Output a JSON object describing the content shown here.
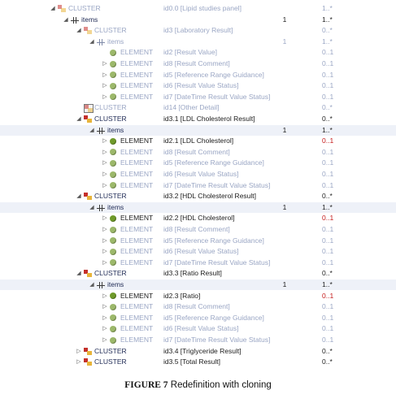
{
  "rows": [
    {
      "depth": 0,
      "expander": "collapse",
      "kind": "cluster",
      "label": "CLUSTER",
      "text": "id0.0 [Lipid studies panel]",
      "occ": "",
      "card": "1..*",
      "dim": true
    },
    {
      "depth": 1,
      "expander": "collapse",
      "kind": "items",
      "label": "items",
      "text": "",
      "occ": "1",
      "card": "1..*",
      "dim": false
    },
    {
      "depth": 2,
      "expander": "collapse",
      "kind": "cluster",
      "label": "CLUSTER",
      "text": "id3 [Laboratory Result]",
      "occ": "",
      "card": "0..*",
      "dim": true
    },
    {
      "depth": 3,
      "expander": "collapse",
      "kind": "items",
      "label": "items",
      "text": "",
      "occ": "1",
      "card": "1..*",
      "dim": true
    },
    {
      "depth": 4,
      "expander": "none",
      "kind": "element",
      "label": "ELEMENT",
      "text": "id2 [Result Value]",
      "occ": "",
      "card": "0..1",
      "dim": true
    },
    {
      "depth": 4,
      "expander": "expand",
      "kind": "element",
      "label": "ELEMENT",
      "text": "id8 [Result Comment]",
      "occ": "",
      "card": "0..1",
      "dim": true
    },
    {
      "depth": 4,
      "expander": "expand",
      "kind": "element",
      "label": "ELEMENT",
      "text": "id5 [Reference Range Guidance]",
      "occ": "",
      "card": "0..1",
      "dim": true
    },
    {
      "depth": 4,
      "expander": "expand",
      "kind": "element",
      "label": "ELEMENT",
      "text": "id6 [Result Value Status]",
      "occ": "",
      "card": "0..1",
      "dim": true
    },
    {
      "depth": 4,
      "expander": "expand",
      "kind": "element",
      "label": "ELEMENT",
      "text": "id7 [DateTime Result Value Status]",
      "occ": "",
      "card": "0..1",
      "dim": true
    },
    {
      "depth": 2,
      "expander": "none",
      "kind": "cluster-slot",
      "label": "CLUSTER",
      "text": "id14 [Other Detail]",
      "occ": "",
      "card": "0..*",
      "dim": true
    },
    {
      "depth": 2,
      "expander": "collapse",
      "kind": "cluster",
      "label": "CLUSTER",
      "text": "id3.1 [LDL Cholesterol Result]",
      "occ": "",
      "card": "0..*",
      "dim": false
    },
    {
      "depth": 3,
      "expander": "collapse",
      "kind": "items",
      "label": "items",
      "text": "",
      "occ": "1",
      "card": "1..*",
      "dim": false,
      "sel": true
    },
    {
      "depth": 4,
      "expander": "expand",
      "kind": "element",
      "label": "ELEMENT",
      "text": "id2.1 [LDL Cholesterol]",
      "occ": "",
      "card": "0..1",
      "dim": false,
      "red": true
    },
    {
      "depth": 4,
      "expander": "expand",
      "kind": "element",
      "label": "ELEMENT",
      "text": "id8 [Result Comment]",
      "occ": "",
      "card": "0..1",
      "dim": true
    },
    {
      "depth": 4,
      "expander": "expand",
      "kind": "element",
      "label": "ELEMENT",
      "text": "id5 [Reference Range Guidance]",
      "occ": "",
      "card": "0..1",
      "dim": true
    },
    {
      "depth": 4,
      "expander": "expand",
      "kind": "element",
      "label": "ELEMENT",
      "text": "id6 [Result Value Status]",
      "occ": "",
      "card": "0..1",
      "dim": true
    },
    {
      "depth": 4,
      "expander": "expand",
      "kind": "element",
      "label": "ELEMENT",
      "text": "id7 [DateTime Result Value Status]",
      "occ": "",
      "card": "0..1",
      "dim": true
    },
    {
      "depth": 2,
      "expander": "collapse",
      "kind": "cluster",
      "label": "CLUSTER",
      "text": "id3.2 [HDL Cholesterol Result]",
      "occ": "",
      "card": "0..*",
      "dim": false
    },
    {
      "depth": 3,
      "expander": "collapse",
      "kind": "items",
      "label": "items",
      "text": "",
      "occ": "1",
      "card": "1..*",
      "dim": false,
      "sel": true
    },
    {
      "depth": 4,
      "expander": "expand",
      "kind": "element",
      "label": "ELEMENT",
      "text": "id2.2 [HDL Cholesterol]",
      "occ": "",
      "card": "0..1",
      "dim": false,
      "red": true
    },
    {
      "depth": 4,
      "expander": "expand",
      "kind": "element",
      "label": "ELEMENT",
      "text": "id8 [Result Comment]",
      "occ": "",
      "card": "0..1",
      "dim": true
    },
    {
      "depth": 4,
      "expander": "expand",
      "kind": "element",
      "label": "ELEMENT",
      "text": "id5 [Reference Range Guidance]",
      "occ": "",
      "card": "0..1",
      "dim": true
    },
    {
      "depth": 4,
      "expander": "expand",
      "kind": "element",
      "label": "ELEMENT",
      "text": "id6 [Result Value Status]",
      "occ": "",
      "card": "0..1",
      "dim": true
    },
    {
      "depth": 4,
      "expander": "expand",
      "kind": "element",
      "label": "ELEMENT",
      "text": "id7 [DateTime Result Value Status]",
      "occ": "",
      "card": "0..1",
      "dim": true
    },
    {
      "depth": 2,
      "expander": "collapse",
      "kind": "cluster",
      "label": "CLUSTER",
      "text": "id3.3 [Ratio Result]",
      "occ": "",
      "card": "0..*",
      "dim": false
    },
    {
      "depth": 3,
      "expander": "collapse",
      "kind": "items",
      "label": "items",
      "text": "",
      "occ": "1",
      "card": "1..*",
      "dim": false,
      "sel": true
    },
    {
      "depth": 4,
      "expander": "expand",
      "kind": "element",
      "label": "ELEMENT",
      "text": "id2.3 [Ratio]",
      "occ": "",
      "card": "0..1",
      "dim": false,
      "red": true
    },
    {
      "depth": 4,
      "expander": "expand",
      "kind": "element",
      "label": "ELEMENT",
      "text": "id8 [Result Comment]",
      "occ": "",
      "card": "0..1",
      "dim": true
    },
    {
      "depth": 4,
      "expander": "expand",
      "kind": "element",
      "label": "ELEMENT",
      "text": "id5 [Reference Range Guidance]",
      "occ": "",
      "card": "0..1",
      "dim": true
    },
    {
      "depth": 4,
      "expander": "expand",
      "kind": "element",
      "label": "ELEMENT",
      "text": "id6 [Result Value Status]",
      "occ": "",
      "card": "0..1",
      "dim": true
    },
    {
      "depth": 4,
      "expander": "expand",
      "kind": "element",
      "label": "ELEMENT",
      "text": "id7 [DateTime Result Value Status]",
      "occ": "",
      "card": "0..1",
      "dim": true
    },
    {
      "depth": 2,
      "expander": "expand",
      "kind": "cluster",
      "label": "CLUSTER",
      "text": "id3.4 [Triglyceride Result]",
      "occ": "",
      "card": "0..*",
      "dim": false
    },
    {
      "depth": 2,
      "expander": "expand",
      "kind": "cluster",
      "label": "CLUSTER",
      "text": "id3.5 [Total Result]",
      "occ": "",
      "card": "0..*",
      "dim": false
    }
  ],
  "colors": {
    "cluster_red": "#c4302b",
    "cluster_yellow": "#e8b43a",
    "element_green": "#6f9a2a",
    "element_green_dim": "#9cb86a",
    "bold_text": "#1f2a55",
    "dim_text": "#9aa6c4",
    "changed": "#c41818",
    "selection": "#eef1f8"
  },
  "caption": {
    "figure": "FIGURE  7",
    "text": "Redefinition with cloning"
  }
}
